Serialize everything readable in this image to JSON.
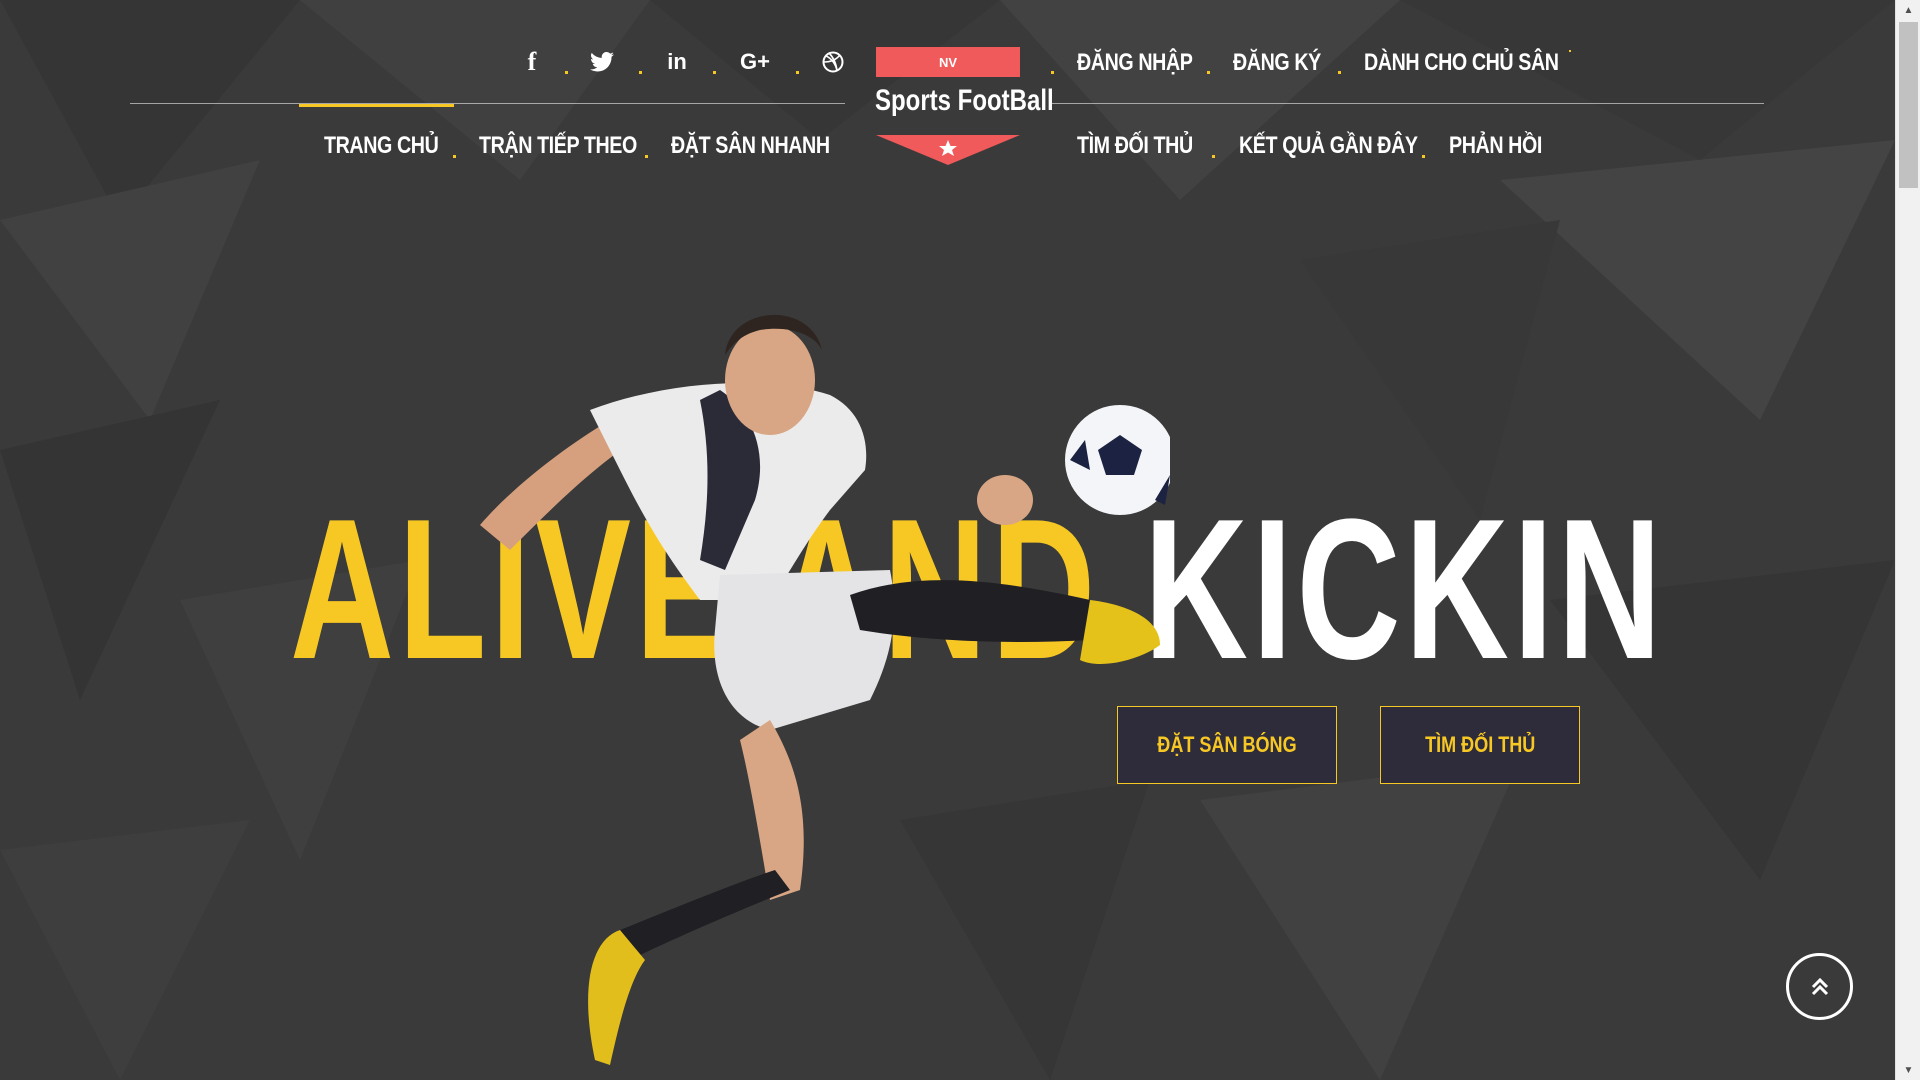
{
  "social": {
    "facebook": "f",
    "linkedin": "in",
    "googleplus": "G+"
  },
  "logo": {
    "badge": "NV",
    "title": "Sports FootBall"
  },
  "top_nav": [
    {
      "label": "ĐĂNG NHẬP"
    },
    {
      "label": "ĐĂNG KÝ"
    },
    {
      "label": "DÀNH CHO CHỦ SÂN"
    }
  ],
  "main_nav_left": [
    {
      "label": "TRANG CHỦ",
      "active": true
    },
    {
      "label": "TRẬN TIẾP THEO"
    },
    {
      "label": "ĐẶT SÂN NHANH"
    }
  ],
  "main_nav_right": [
    {
      "label": "TÌM ĐỐI THỦ"
    },
    {
      "label": "KẾT QUẢ GẦN ĐÂY"
    },
    {
      "label": "PHẢN HỒI"
    }
  ],
  "hero": {
    "headline_yellow": "ALIVE AND",
    "headline_white": "KICKIN"
  },
  "buttons": {
    "book_field": "ĐẶT SÂN BÓNG",
    "find_opponent": "TÌM ĐỐI THỦ"
  },
  "colors": {
    "accent": "#f7c824",
    "badge": "#f05a5a",
    "background": "#3b3b3b",
    "button_bg": "#2e2c3a"
  },
  "icons": [
    "facebook-icon",
    "twitter-icon",
    "linkedin-icon",
    "googleplus-icon",
    "dribbble-icon",
    "star-icon",
    "chevron-double-up-icon"
  ]
}
